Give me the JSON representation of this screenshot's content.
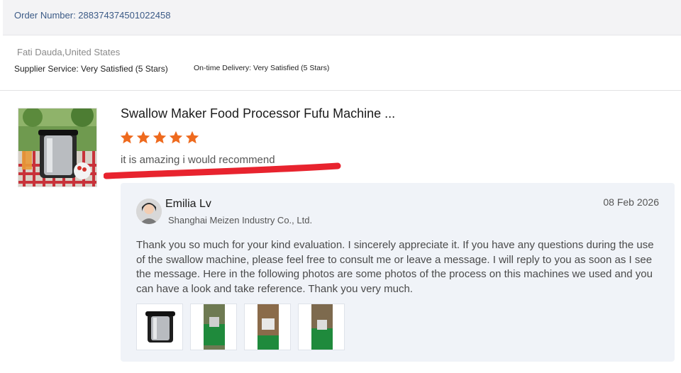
{
  "order": {
    "number_text": "Order Number: 288374374501022458"
  },
  "buyer": {
    "name_country": "Fati Dauda,United States",
    "supplier_service_rating": "Supplier Service: Very Satisfied (5 Stars)",
    "ontime_delivery_rating": "On-time Delivery: Very Satisfied (5 Stars)"
  },
  "review": {
    "product_title": "Swallow Maker Food Processor Fufu Machine ...",
    "stars": 5,
    "text": "it is amazing i would recommend"
  },
  "reply": {
    "name": "Emilia Lv",
    "company": "Shanghai Meizen Industry Co., Ltd.",
    "date": "08 Feb 2026",
    "text": "Thank you so much for your kind evaluation. I sincerely appreciate it. If you have any questions during the use of the swallow machine, please feel free to consult me or leave a message. I will reply to you as soon as I see the message. Here in the following photos are some photos of the process on this machines we used and you can have a look and take reference. Thank you very much.",
    "photo_count": 4
  },
  "colors": {
    "star": "#ee6a1e",
    "annotation_underline": "#e8232e",
    "order_number": "#3b5a86",
    "reply_background": "#f0f3f8"
  },
  "icons": {
    "star": "star-icon",
    "avatar": "avatar"
  }
}
